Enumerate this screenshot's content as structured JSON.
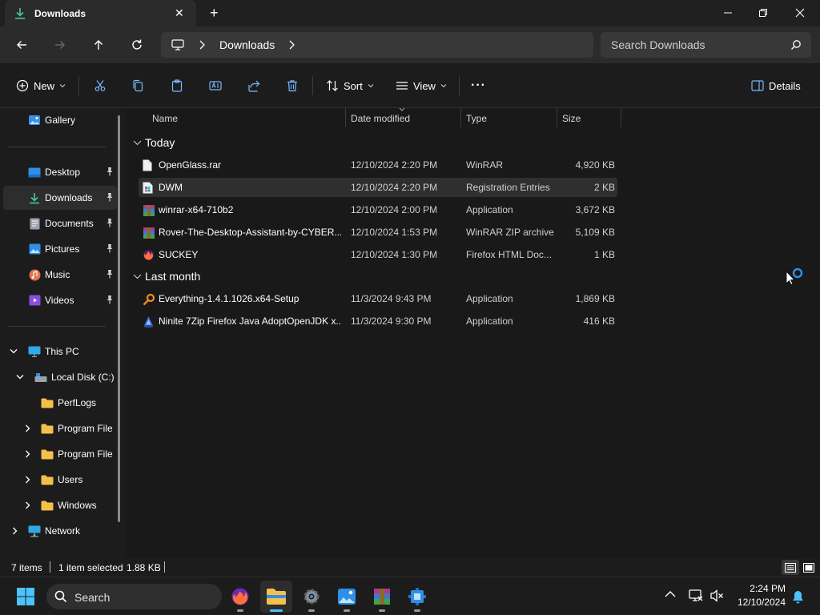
{
  "window": {
    "tab_title": "Downloads",
    "new_tab_glyph": "+",
    "minimize_glyph": "—",
    "maximize_glyph": "❐",
    "close_glyph": "✕"
  },
  "nav": {
    "breadcrumb": [
      "Downloads"
    ],
    "search_placeholder": "Search Downloads"
  },
  "commands": {
    "new_label": "New",
    "sort_label": "Sort",
    "view_label": "View",
    "more_label": "···",
    "details_label": "Details"
  },
  "sidebar": {
    "gallery": "Gallery",
    "desktop": "Desktop",
    "downloads": "Downloads",
    "documents": "Documents",
    "pictures": "Pictures",
    "music": "Music",
    "videos": "Videos",
    "this_pc": "This PC",
    "local_disk": "Local Disk (C:)",
    "perflogs": "PerfLogs",
    "program_files_1": "Program File",
    "program_files_2": "Program File",
    "users": "Users",
    "windows": "Windows",
    "network": "Network"
  },
  "columns": {
    "name": "Name",
    "date": "Date modified",
    "type": "Type",
    "size": "Size"
  },
  "groups": [
    {
      "label": "Today",
      "files": [
        {
          "name": "OpenGlass.rar",
          "date": "12/10/2024 2:20 PM",
          "type": "WinRAR",
          "size": "4,920 KB",
          "icon": "file-icon"
        },
        {
          "name": "DWM",
          "date": "12/10/2024 2:20 PM",
          "type": "Registration Entries",
          "size": "2 KB",
          "icon": "registry-file-icon"
        },
        {
          "name": "winrar-x64-710b2",
          "date": "12/10/2024 2:00 PM",
          "type": "Application",
          "size": "3,672 KB",
          "icon": "winrar-icon"
        },
        {
          "name": "Rover-The-Desktop-Assistant-by-CYBER...",
          "date": "12/10/2024 1:53 PM",
          "type": "WinRAR ZIP archive",
          "size": "5,109 KB",
          "icon": "winrar-archive-icon"
        },
        {
          "name": "SUCKEY",
          "date": "12/10/2024 1:30 PM",
          "type": "Firefox HTML Doc...",
          "size": "1 KB",
          "icon": "firefox-doc-icon"
        }
      ]
    },
    {
      "label": "Last month",
      "files": [
        {
          "name": "Everything-1.4.1.1026.x64-Setup",
          "date": "11/3/2024 9:43 PM",
          "type": "Application",
          "size": "1,869 KB",
          "icon": "everything-icon"
        },
        {
          "name": "Ninite 7Zip Firefox Java AdoptOpenJDK x...",
          "date": "11/3/2024 9:30 PM",
          "type": "Application",
          "size": "416 KB",
          "icon": "ninite-icon"
        }
      ]
    }
  ],
  "status": {
    "items": "7 items",
    "selection": "1 item selected",
    "selection_size": "1.88 KB"
  },
  "taskbar": {
    "search_label": "Search",
    "time": "2:24 PM",
    "date": "12/10/2024"
  },
  "colors": {
    "accent": "#4cc2ff",
    "folder": "#f5c04a"
  }
}
